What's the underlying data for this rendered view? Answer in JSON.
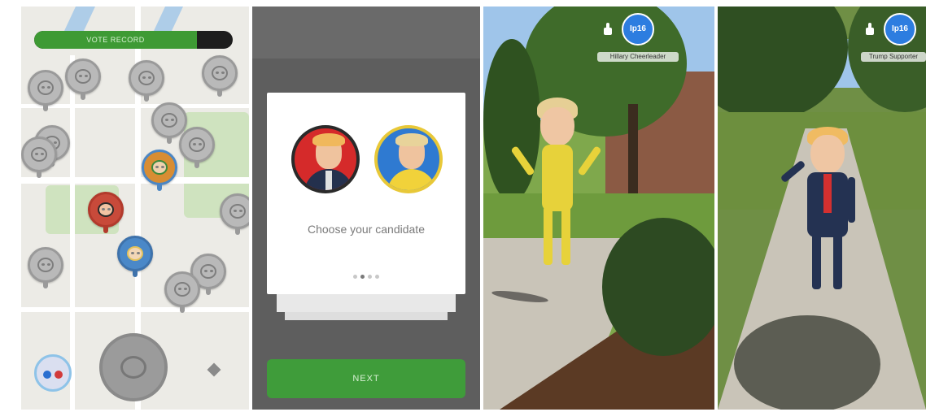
{
  "map_screen": {
    "progress": {
      "label": "VOTE RECORD",
      "fill_fraction": 0.82,
      "color": "#3e9a34"
    },
    "pins": [
      {
        "kind": "generic"
      },
      {
        "kind": "generic"
      },
      {
        "kind": "generic"
      },
      {
        "kind": "generic"
      },
      {
        "kind": "generic"
      },
      {
        "kind": "generic"
      },
      {
        "kind": "generic"
      },
      {
        "kind": "generic"
      },
      {
        "kind": "mixed"
      },
      {
        "kind": "trump"
      },
      {
        "kind": "clinton"
      },
      {
        "kind": "generic"
      },
      {
        "kind": "generic"
      },
      {
        "kind": "generic"
      },
      {
        "kind": "generic"
      }
    ],
    "icons": {
      "user": "user-avatar-icon",
      "locate": "locate-icon",
      "big_pin": "map-pin-icon"
    }
  },
  "chooser_screen": {
    "prompt": "Choose your candidate",
    "candidates": [
      {
        "name": "Trump",
        "ring_color": "#2a2a2a",
        "bg_color": "#d52a2a"
      },
      {
        "name": "Clinton",
        "ring_color": "#e8c838",
        "bg_color": "#2f7ad1"
      }
    ],
    "page_dots": 4,
    "active_dot": 1,
    "next_label": "NEXT"
  },
  "ar_screen_1": {
    "badge": "Ip16",
    "username": "Hillary Cheerleader"
  },
  "ar_screen_2": {
    "badge": "Ip16",
    "username": "Trump Supporter"
  }
}
